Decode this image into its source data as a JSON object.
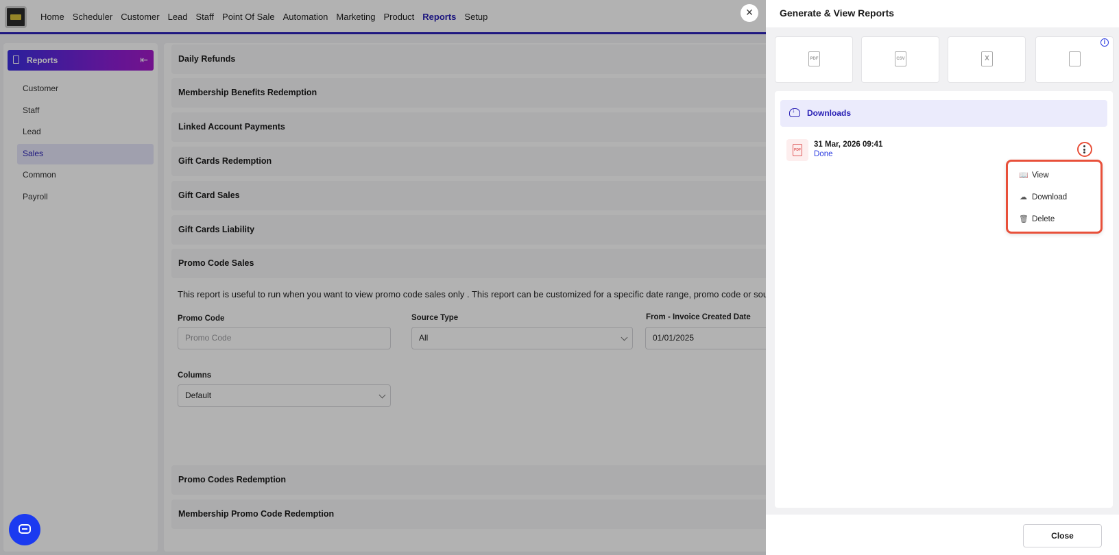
{
  "nav": {
    "items": [
      "Home",
      "Scheduler",
      "Customer",
      "Lead",
      "Staff",
      "Point Of Sale",
      "Automation",
      "Marketing",
      "Product",
      "Reports",
      "Setup"
    ],
    "active": "Reports"
  },
  "sidebar": {
    "title": "Reports",
    "items": [
      {
        "label": "Customer"
      },
      {
        "label": "Staff"
      },
      {
        "label": "Lead"
      },
      {
        "label": "Sales"
      },
      {
        "label": "Common"
      },
      {
        "label": "Payroll"
      }
    ],
    "active": "Sales"
  },
  "main": {
    "sections": [
      "Daily Refunds",
      "Membership Benefits Redemption",
      "Linked Account Payments",
      "Gift Cards Redemption",
      "Gift Card Sales",
      "Gift Cards Liability",
      "Promo Code Sales",
      "Promo Codes Redemption",
      "Membership Promo Code Redemption"
    ],
    "description": "This report is useful to run when you want to view promo code sales only . This report can be customized for a specific date range, promo code or source type",
    "form": {
      "promo_code_label": "Promo Code",
      "promo_code_placeholder": "Promo Code",
      "source_type_label": "Source Type",
      "source_type_value": "All",
      "from_date_label": "From - Invoice Created Date",
      "from_date_value": "01/01/2025",
      "columns_label": "Columns",
      "columns_value": "Default"
    }
  },
  "drawer": {
    "title": "Generate & View Reports",
    "formats": [
      {
        "icon": "pdf-file-icon",
        "glyph": "PDF"
      },
      {
        "icon": "csv-file-icon",
        "glyph": "CSV"
      },
      {
        "icon": "excel-file-icon",
        "glyph": "X"
      },
      {
        "icon": "contact-file-icon",
        "glyph": ""
      }
    ],
    "downloads_label": "Downloads",
    "report": {
      "date": "31 Mar, 2026 09:41",
      "status": "Done",
      "icon_label": "PDF"
    },
    "menu": [
      {
        "label": "View",
        "icon": "book-icon"
      },
      {
        "label": "Download",
        "icon": "cloud-download-icon"
      },
      {
        "label": "Delete",
        "icon": "trash-icon"
      }
    ],
    "close_label": "Close"
  },
  "colors": {
    "accent": "#2920b5",
    "highlight": "#e8503a",
    "chat": "#1b3af0"
  }
}
